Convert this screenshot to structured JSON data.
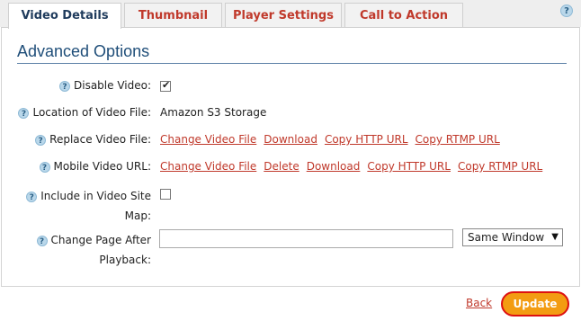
{
  "tabs": [
    {
      "label": "Video Details"
    },
    {
      "label": "Thumbnail"
    },
    {
      "label": "Player Settings"
    },
    {
      "label": "Call to Action"
    }
  ],
  "help_glyph": "?",
  "section": {
    "title": "Advanced Options"
  },
  "fields": {
    "disable_video": {
      "label": "Disable Video:",
      "checked": true
    },
    "location": {
      "label": "Location of Video File:",
      "value": "Amazon S3 Storage"
    },
    "replace": {
      "label": "Replace Video File:",
      "links": [
        "Change Video File",
        "Download",
        "Copy HTTP URL",
        "Copy RTMP URL"
      ]
    },
    "mobile": {
      "label": "Mobile Video URL:",
      "links": [
        "Change Video File",
        "Delete",
        "Download",
        "Copy HTTP URL",
        "Copy RTMP URL"
      ]
    },
    "sitemap": {
      "label_line1": "Include in Video Site",
      "label_line2": "Map:",
      "checked": false
    },
    "change_page": {
      "label_line1": "Change Page After",
      "label_line2": "Playback:",
      "input_value": "",
      "select_value": "Same Window"
    }
  },
  "footer": {
    "back_label": "Back",
    "update_label": "Update"
  },
  "colors": {
    "accent_link": "#c0392b",
    "update_button": "#f39c12",
    "update_outline": "#dd1111",
    "title": "#1f4e79"
  }
}
